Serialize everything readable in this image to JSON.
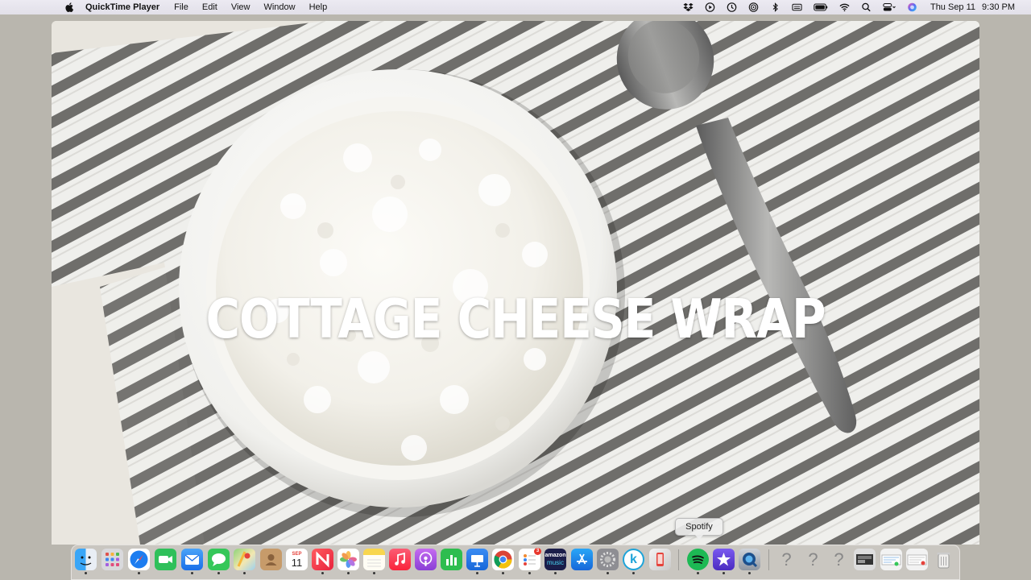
{
  "menubar": {
    "app_name": "QuickTime Player",
    "menus": [
      "File",
      "Edit",
      "View",
      "Window",
      "Help"
    ],
    "date": "Thu Sep 11",
    "time": "9:30 PM",
    "status_icons": [
      "dropbox-icon",
      "play-circle-icon",
      "time-machine-icon",
      "airdrop-icon",
      "bluetooth-icon",
      "keyboard-input-icon",
      "battery-icon",
      "wifi-icon",
      "search-icon",
      "control-center-icon",
      "siri-icon"
    ]
  },
  "video": {
    "title": "COTTAGE CHEESE WRAP"
  },
  "tooltip": {
    "label": "Spotify"
  },
  "dock": {
    "calendar": {
      "month": "SEP",
      "day": "11"
    },
    "amazon_music": {
      "line1": "amazon",
      "line2": "music"
    },
    "keynote_letter": "k",
    "question_marks": [
      "?",
      "?",
      "?"
    ],
    "reminders_badge": "3",
    "apps": [
      "Finder",
      "Launchpad",
      "Safari",
      "FaceTime",
      "Mail",
      "Messages",
      "Maps",
      "Contacts",
      "Calendar",
      "News",
      "Photos",
      "Notes",
      "Music",
      "Podcasts",
      "Numbers",
      "Keynote",
      "Chrome",
      "Reminders",
      "Amazon Music",
      "App Store",
      "System Preferences",
      "K App",
      "Phone Mirroring",
      "Spotify",
      "iMovie",
      "QuickTime Player"
    ],
    "colors": {
      "finder": "#2f8ef0",
      "safari": "#1d7df0",
      "facetime": "#2fc05a",
      "messages": "#35c759",
      "music": "#fb3c56",
      "podcasts": "#9b4be0",
      "numbers": "#2ebd4f",
      "spotify": "#1db954",
      "appstore": "#1d8ef5",
      "amazon": "#1b1e4a"
    }
  }
}
